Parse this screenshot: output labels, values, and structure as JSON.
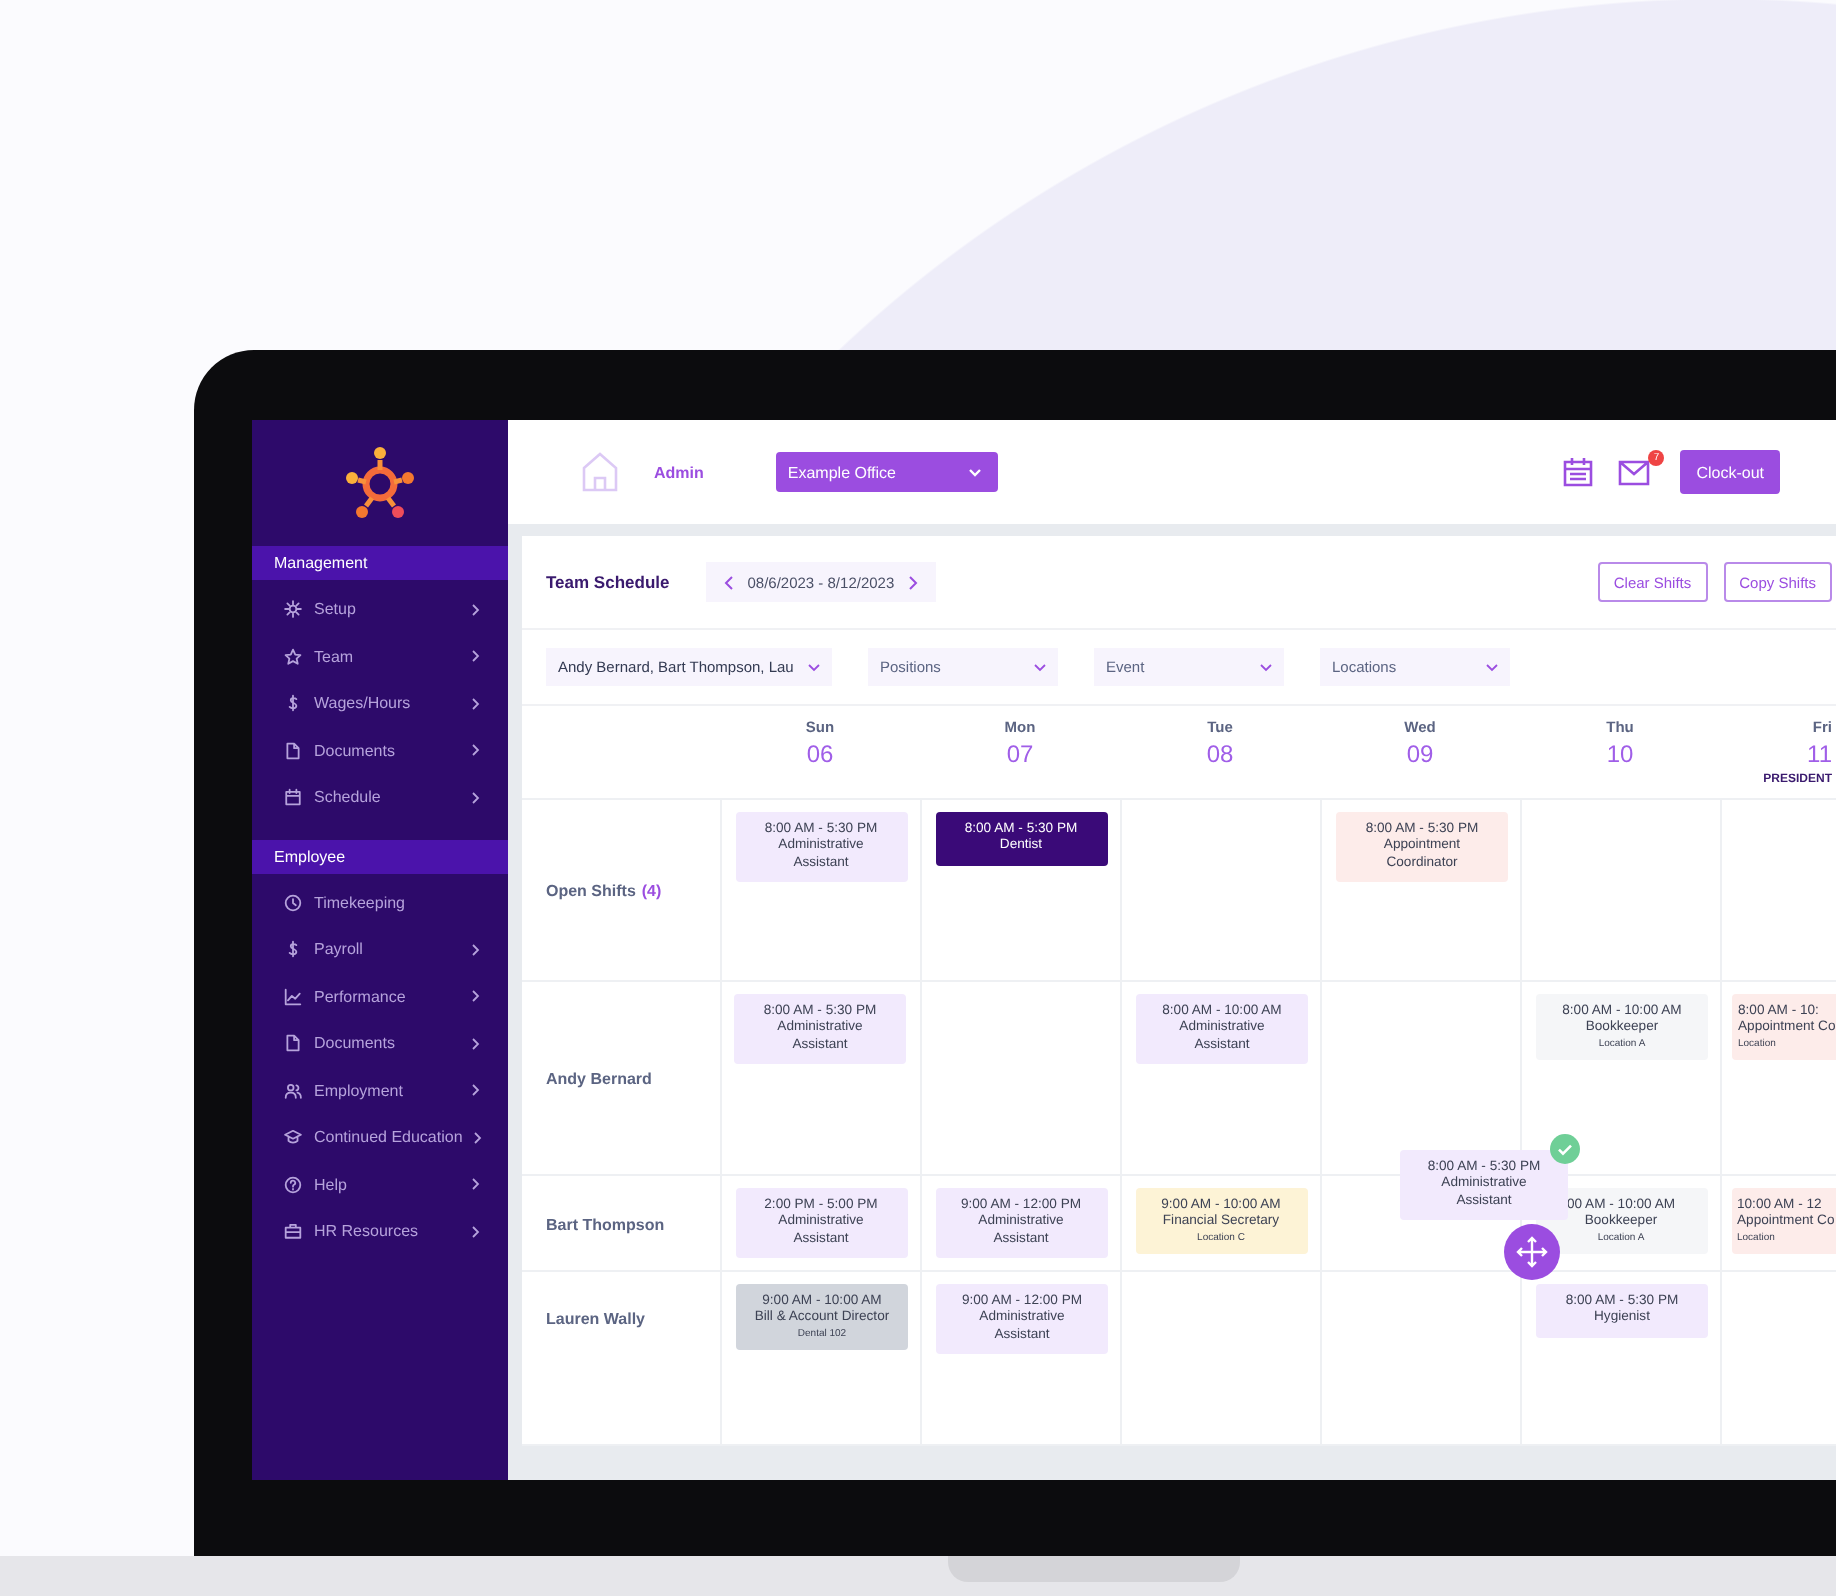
{
  "sidebar": {
    "sections": [
      {
        "title": "Management",
        "items": [
          {
            "label": "Setup",
            "submenu": true
          },
          {
            "label": "Team",
            "submenu": true
          },
          {
            "label": "Wages/Hours",
            "submenu": true
          },
          {
            "label": "Documents",
            "submenu": true
          },
          {
            "label": "Schedule",
            "submenu": true
          }
        ]
      },
      {
        "title": "Employee",
        "items": [
          {
            "label": "Timekeeping",
            "submenu": false
          },
          {
            "label": "Payroll",
            "submenu": true
          },
          {
            "label": "Performance",
            "submenu": true
          },
          {
            "label": "Documents",
            "submenu": true
          },
          {
            "label": "Employment",
            "submenu": true
          },
          {
            "label": "Continued Education",
            "submenu": true
          },
          {
            "label": "Help",
            "submenu": true
          },
          {
            "label": "HR Resources",
            "submenu": true
          }
        ]
      }
    ]
  },
  "topbar": {
    "role": "Admin",
    "office": "Example Office",
    "mail_badge": "7",
    "clock_out": "Clock-out"
  },
  "schedule": {
    "title": "Team Schedule",
    "date_range": "08/6/2023 - 8/12/2023",
    "buttons": [
      "Clear Shifts",
      "Copy Shifts"
    ],
    "filters": [
      {
        "value": "Andy Bernard, Bart Thompson, Lau"
      },
      {
        "placeholder": "Positions"
      },
      {
        "placeholder": "Event"
      },
      {
        "placeholder": "Locations"
      }
    ],
    "days": [
      {
        "name": "Sun",
        "date": "06"
      },
      {
        "name": "Mon",
        "date": "07"
      },
      {
        "name": "Tue",
        "date": "08"
      },
      {
        "name": "Wed",
        "date": "09"
      },
      {
        "name": "Thu",
        "date": "10"
      },
      {
        "name": "Fri",
        "date": "11",
        "holiday": "PRESIDENT"
      }
    ],
    "rows": [
      {
        "name": "Open Shifts",
        "count": "(4)",
        "cells": [
          [
            {
              "time": "8:00 AM - 5:30 PM",
              "role": "Administrative Assistant",
              "color": "#f2eafd",
              "kind": "middle"
            }
          ],
          [
            {
              "time": "8:00 AM - 5:30 PM",
              "role": "Dentist",
              "color": "#3a0a78",
              "kind": "middle"
            }
          ],
          [],
          [
            {
              "time": "8:00 AM - 5:30 PM",
              "role": "Appointment Coordinator",
              "color": "#fdecea",
              "kind": "top"
            }
          ],
          [],
          []
        ]
      },
      {
        "name": "Andy Bernard",
        "cells": [
          [
            {
              "time": "8:00 AM - 5:30 PM",
              "role": "Administrative Assistant",
              "color": "#f2eafd",
              "kind": "bottom"
            }
          ],
          [],
          [
            {
              "time": "8:00 AM - 10:00 AM",
              "role": "Administrative Assistant",
              "color": "#f2eafd",
              "kind": "top"
            }
          ],
          [],
          [
            {
              "time": "8:00 AM - 10:00 AM",
              "role": "Bookkeeper",
              "location": "Location A",
              "color": "#f5f6f8",
              "kind": "top"
            }
          ],
          [
            {
              "time": "8:00 AM - 10:",
              "role": "Appointment Co",
              "location": "Location",
              "color": "#fdecea",
              "kind": "top"
            }
          ]
        ]
      },
      {
        "name": "Bart Thompson",
        "cells": [
          [
            {
              "time": "2:00 PM - 5:00 PM",
              "role": "Administrative Assistant",
              "color": "#f2eafd",
              "kind": "middle"
            }
          ],
          [
            {
              "time": "9:00 AM - 12:00 PM",
              "role": "Administrative Assistant",
              "color": "#f2eafd",
              "kind": "middle"
            }
          ],
          [
            {
              "time": "9:00 AM - 10:00 AM",
              "role": "Financial Secretary",
              "location": "Location C",
              "color": "#fdf3d6",
              "kind": "middle"
            }
          ],
          [],
          [
            {
              "time": "00 AM - 10:00 AM",
              "role": "Bookkeeper",
              "location": "Location A",
              "color": "#f5f6f8",
              "kind": "middle"
            }
          ],
          [
            {
              "time": "10:00 AM - 12",
              "role": "Appointment Co",
              "location": "Location",
              "color": "#fdecea",
              "kind": "middle"
            }
          ]
        ]
      },
      {
        "name": "Lauren Wally",
        "cells": [
          [
            {
              "time": "9:00 AM - 10:00 AM",
              "role": "Bill & Account Director",
              "location": "Dental 102",
              "color": "#d1d5dc",
              "kind": "top"
            }
          ],
          [
            {
              "time": "9:00 AM - 12:00 PM",
              "role": "Administrative Assistant",
              "color": "#f2eafd",
              "kind": "top"
            }
          ],
          [],
          [],
          [
            {
              "time": "8:00 AM - 5:30 PM",
              "role": "Hygienist",
              "color": "#f2eafd",
              "kind": "top"
            }
          ],
          []
        ]
      }
    ],
    "drag_preview": {
      "time": "8:00 AM - 5:30 PM",
      "role": "Administrative Assistant"
    }
  }
}
